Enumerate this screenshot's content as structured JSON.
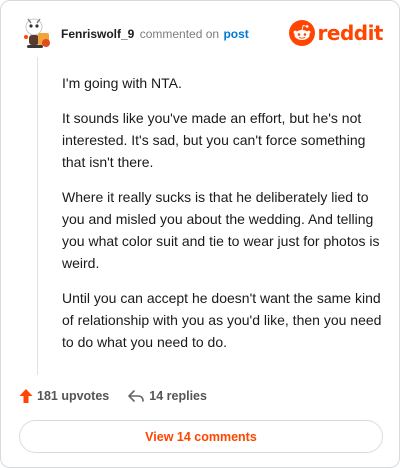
{
  "header": {
    "author": "Fenriswolf_9",
    "action_text": "commented on",
    "post_link": "post",
    "brand": "reddit",
    "avatar_icon": "snoo-avatar-icon",
    "brand_icon": "reddit-snoo-icon",
    "brand_color": "#ff4500"
  },
  "comment": {
    "paragraphs": [
      "I'm going with NTA.",
      "It sounds like you've made an effort, but he's not interested. It's sad, but you can't force something that isn't there.",
      "Where it really sucks is that he deliberately lied to you and misled you about the wedding. And telling you what color suit and tie to wear just for photos is weird.",
      "Until you can accept he doesn't want the same kind of relationship with you as you'd like, then you need to do what you need to do."
    ]
  },
  "actions": {
    "upvotes": "181 upvotes",
    "replies": "14 replies",
    "upvote_icon": "upvote-arrow-icon",
    "reply_icon": "reply-arrow-icon"
  },
  "footer": {
    "view_comments": "View 14 comments"
  }
}
